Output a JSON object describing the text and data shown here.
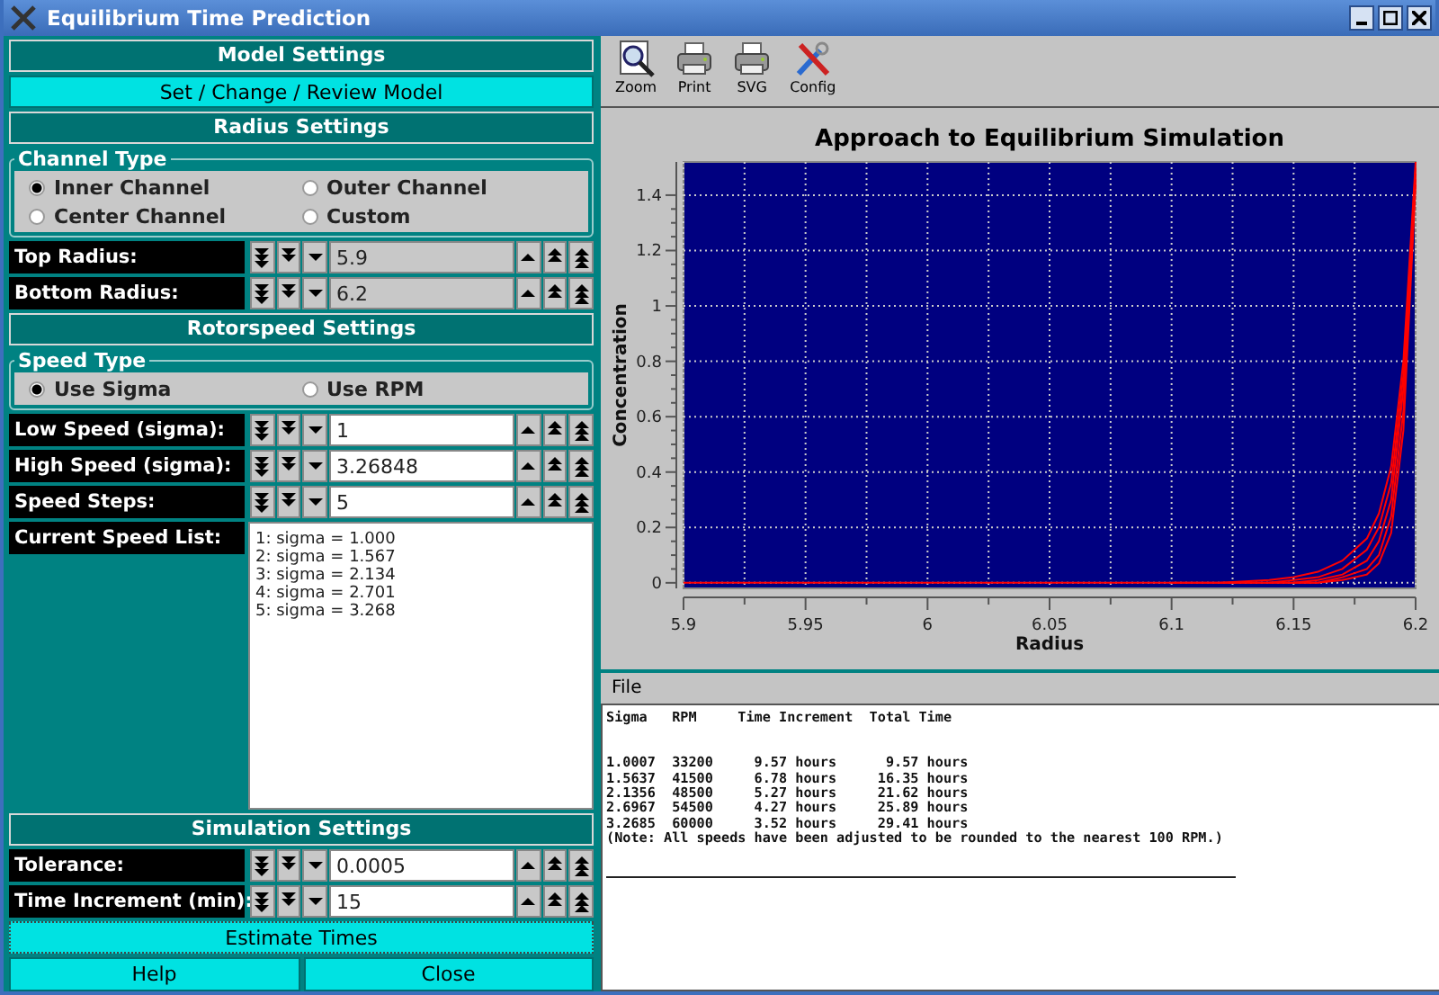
{
  "window": {
    "title": "Equilibrium Time Prediction"
  },
  "model_settings": {
    "header": "Model Settings",
    "button": "Set / Change / Review Model"
  },
  "radius_settings": {
    "header": "Radius Settings",
    "group": "Channel Type",
    "options": [
      {
        "label": "Inner Channel",
        "selected": true
      },
      {
        "label": "Outer Channel",
        "selected": false
      },
      {
        "label": "Center Channel",
        "selected": false
      },
      {
        "label": "Custom",
        "selected": false
      }
    ],
    "fields": [
      {
        "label": "Top Radius:",
        "value": "5.9",
        "disabled": true
      },
      {
        "label": "Bottom Radius:",
        "value": "6.2",
        "disabled": true
      }
    ]
  },
  "rotorspeed_settings": {
    "header": "Rotorspeed Settings",
    "group": "Speed Type",
    "options": [
      {
        "label": "Use Sigma",
        "selected": true
      },
      {
        "label": "Use RPM",
        "selected": false
      }
    ],
    "fields": [
      {
        "label": "Low Speed (sigma):",
        "value": "1",
        "disabled": false
      },
      {
        "label": "High Speed (sigma):",
        "value": "3.26848",
        "disabled": false
      },
      {
        "label": "Speed Steps:",
        "value": "5",
        "disabled": false
      }
    ],
    "list_label": "Current Speed List:",
    "speed_list": [
      "1: sigma = 1.000",
      "2: sigma = 1.567",
      "3: sigma = 2.134",
      "4: sigma = 2.701",
      "5: sigma = 3.268"
    ]
  },
  "simulation_settings": {
    "header": "Simulation Settings",
    "fields": [
      {
        "label": "Tolerance:",
        "value": "0.0005",
        "disabled": false
      },
      {
        "label": "Time Increment (min):",
        "value": "15",
        "disabled": false
      }
    ],
    "estimate_button": "Estimate Times"
  },
  "buttons": [
    "Help",
    "Close"
  ],
  "toolbar": [
    {
      "label": "Zoom",
      "kind": "zoom"
    },
    {
      "label": "Print",
      "kind": "print"
    },
    {
      "label": "SVG",
      "kind": "print"
    },
    {
      "label": "Config",
      "kind": "config"
    }
  ],
  "plot": {
    "chart_data": {
      "type": "line",
      "title": "Approach to Equilibrium Simulation",
      "xlabel": "Radius",
      "ylabel": "Concentration",
      "x": [
        5.9,
        6.1,
        6.12,
        6.14,
        6.15,
        6.16,
        6.17,
        6.18,
        6.185,
        6.19,
        6.195,
        6.2
      ],
      "grid": true,
      "xlim": [
        5.9,
        6.2
      ],
      "ylim": [
        -0.02,
        1.52
      ],
      "xticks": [
        5.9,
        5.95,
        6,
        6.05,
        6.1,
        6.15,
        6.2
      ],
      "yticks": [
        0,
        0.2,
        0.4,
        0.6,
        0.8,
        1,
        1.2,
        1.4
      ],
      "series": [
        {
          "color": "#ff0000",
          "values": [
            0,
            0,
            0,
            0.01,
            0.02,
            0.04,
            0.08,
            0.16,
            0.25,
            0.42,
            0.8,
            1.52
          ]
        },
        {
          "color": "#ff0000",
          "values": [
            null,
            0,
            0,
            0,
            0.01,
            0.02,
            0.05,
            0.12,
            0.2,
            0.36,
            0.75,
            1.5
          ]
        },
        {
          "color": "#ff0000",
          "values": [
            null,
            null,
            0,
            0,
            0,
            0.01,
            0.03,
            0.08,
            0.15,
            0.3,
            0.7,
            1.48
          ]
        },
        {
          "color": "#ff0000",
          "values": [
            null,
            null,
            null,
            0,
            0,
            0,
            0.02,
            0.05,
            0.1,
            0.24,
            0.62,
            1.46
          ]
        },
        {
          "color": "#ff0000",
          "values": [
            null,
            null,
            null,
            null,
            0,
            0,
            0.01,
            0.03,
            0.07,
            0.18,
            0.55,
            1.44
          ]
        }
      ]
    }
  },
  "output": {
    "menu": "File",
    "header": "Sigma   RPM     Time Increment  Total Time",
    "lines": [
      "1.0007  33200     9.57 hours      9.57 hours",
      "1.5637  41500     6.78 hours     16.35 hours",
      "2.1356  48500     5.27 hours     21.62 hours",
      "2.6967  54500     4.27 hours     25.89 hours",
      "3.2685  60000     3.52 hours     29.41 hours",
      "(Note: All speeds have been adjusted to be rounded to the nearest 100 RPM.)"
    ]
  }
}
